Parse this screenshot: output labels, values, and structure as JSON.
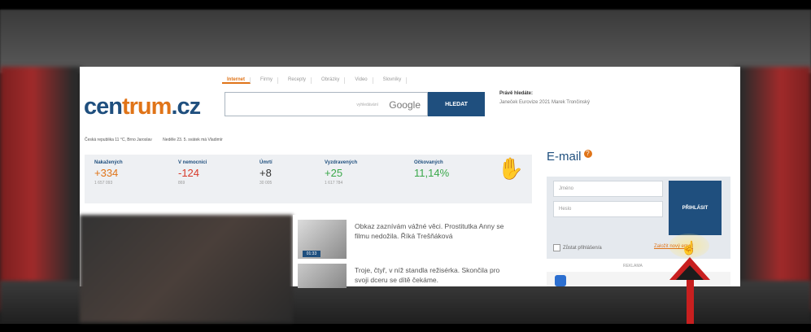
{
  "header": {
    "logo_part1": "cen",
    "logo_part2": "trum",
    "logo_part3": ".cz",
    "tabs": [
      "Internet",
      "Firmy",
      "Recepty",
      "Obrázky",
      "Video",
      "Slovníky"
    ],
    "search_brand": "Google",
    "search_pre": "vyhledávání",
    "search_button": "HLEDAT",
    "trends_title": "Právě hledáte:",
    "trends_items": "Janeček  Eurovize 2021  Marek Trončinský"
  },
  "info_bar": {
    "weather": "Česká republika 11 °C, Brno Jaroslav",
    "nameday": "Neděle 23. 5. svátek má Vladimír"
  },
  "stats": [
    {
      "label": "Nakažených",
      "value": "+334",
      "sub": "1 657 093"
    },
    {
      "label": "V nemocnici",
      "value": "-124",
      "sub": "869"
    },
    {
      "label": "Úmrtí",
      "value": "+8",
      "sub": "30 005"
    },
    {
      "label": "Vyzdravených",
      "value": "+25",
      "sub": "1 617 784"
    },
    {
      "label": "Očkovaných",
      "value": "11,14%",
      "sub": ""
    }
  ],
  "email": {
    "title": "E-mail",
    "badge": "?",
    "username_placeholder": "Jméno",
    "password_placeholder": "Heslo",
    "login_button": "PŘIHLÁSIT",
    "remember": "Zůstat přihlášen/a",
    "create": "Založit nový email",
    "ad_label": "REKLAMA"
  },
  "news": [
    {
      "text": "Obkaz zaznívám vážné věci. Prostitutka Anny se filmu nedožila. Říká Trešňáková",
      "tag": "01:33"
    },
    {
      "text": "Troje, čtyř, v níž standla režisérka. Skončila pro svoji dceru se dítě čekáme."
    }
  ]
}
